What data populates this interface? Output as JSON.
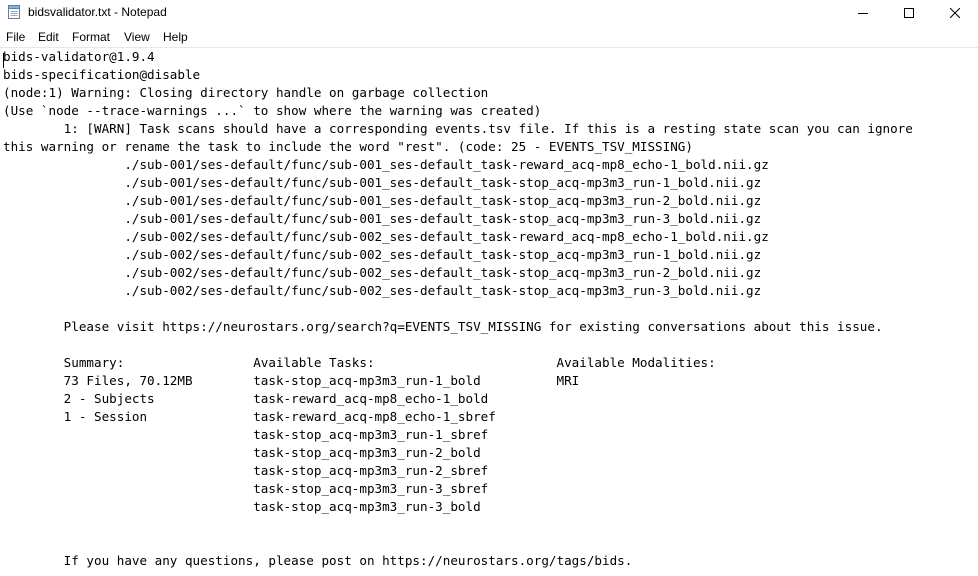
{
  "window": {
    "title": "bidsvalidator.txt - Notepad",
    "icon": "notepad-icon",
    "controls": {
      "minimize": "minimize-icon",
      "maximize": "maximize-icon",
      "close": "close-icon"
    }
  },
  "menu": {
    "file": "File",
    "edit": "Edit",
    "format": "Format",
    "view": "View",
    "help": "Help"
  },
  "document": {
    "lines": [
      "bids-validator@1.9.4",
      "bids-specification@disable",
      "(node:1) Warning: Closing directory handle on garbage collection",
      "(Use `node --trace-warnings ...` to show where the warning was created)",
      "        1: [WARN] Task scans should have a corresponding events.tsv file. If this is a resting state scan you can ignore",
      "this warning or rename the task to include the word \"rest\". (code: 25 - EVENTS_TSV_MISSING)",
      "                ./sub-001/ses-default/func/sub-001_ses-default_task-reward_acq-mp8_echo-1_bold.nii.gz",
      "                ./sub-001/ses-default/func/sub-001_ses-default_task-stop_acq-mp3m3_run-1_bold.nii.gz",
      "                ./sub-001/ses-default/func/sub-001_ses-default_task-stop_acq-mp3m3_run-2_bold.nii.gz",
      "                ./sub-001/ses-default/func/sub-001_ses-default_task-stop_acq-mp3m3_run-3_bold.nii.gz",
      "                ./sub-002/ses-default/func/sub-002_ses-default_task-reward_acq-mp8_echo-1_bold.nii.gz",
      "                ./sub-002/ses-default/func/sub-002_ses-default_task-stop_acq-mp3m3_run-1_bold.nii.gz",
      "                ./sub-002/ses-default/func/sub-002_ses-default_task-stop_acq-mp3m3_run-2_bold.nii.gz",
      "                ./sub-002/ses-default/func/sub-002_ses-default_task-stop_acq-mp3m3_run-3_bold.nii.gz",
      "",
      "        Please visit https://neurostars.org/search?q=EVENTS_TSV_MISSING for existing conversations about this issue.",
      "",
      "        Summary:                 Available Tasks:                        Available Modalities:",
      "        73 Files, 70.12MB        task-stop_acq-mp3m3_run-1_bold          MRI",
      "        2 - Subjects             task-reward_acq-mp8_echo-1_bold",
      "        1 - Session              task-reward_acq-mp8_echo-1_sbref",
      "                                 task-stop_acq-mp3m3_run-1_sbref",
      "                                 task-stop_acq-mp3m3_run-2_bold",
      "                                 task-stop_acq-mp3m3_run-2_sbref",
      "                                 task-stop_acq-mp3m3_run-3_sbref",
      "                                 task-stop_acq-mp3m3_run-3_bold",
      "",
      "",
      "        If you have any questions, please post on https://neurostars.org/tags/bids."
    ]
  }
}
